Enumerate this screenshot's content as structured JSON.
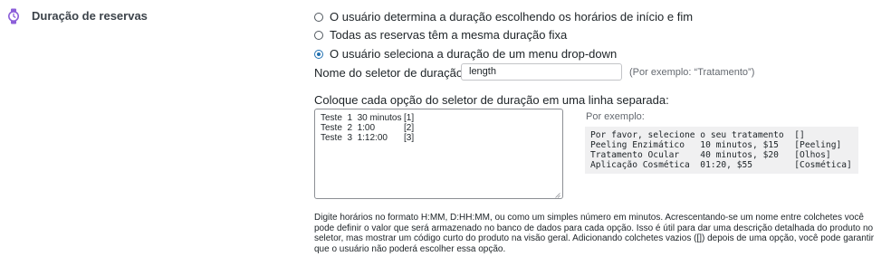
{
  "section": {
    "title": "Duração de reservas",
    "icon": "watch-icon",
    "icon_color": "#8c5fd9"
  },
  "duration_mode": {
    "options": [
      {
        "label": "O usuário determina a duração escolhendo os horários de início e fim",
        "checked": false
      },
      {
        "label": "Todas as reservas têm a mesma duração fixa",
        "checked": false
      },
      {
        "label": "O usuário seleciona a duração de um menu drop-down",
        "checked": true
      }
    ]
  },
  "selector_name": {
    "label": "Nome do seletor de duração:",
    "value": "length",
    "hint": "(Por exemplo: “Tratamento”)"
  },
  "options_list": {
    "label": "Coloque cada opção do seletor de duração em uma linha separada:",
    "lines": [
      {
        "text": "Teste  1  30 minutos",
        "code": "[1]"
      },
      {
        "text": "Teste  2  1:00",
        "code": "[2]"
      },
      {
        "text": "Teste  3  1:12:00",
        "code": "[3]"
      }
    ]
  },
  "example": {
    "label": "Por exemplo:",
    "lines": [
      "Por favor, selecione o seu tratamento  []",
      "Peeling Enzimático   10 minutos, $15   [Peeling]",
      "Tratamento Ocular    40 minutos, $20   [Olhos]",
      "Aplicação Cosmética  01:20, $55        [Cosmética]"
    ]
  },
  "description": "Digite horários no formato H:MM, D:HH:MM, ou como um simples número em minutos. Acrescentando-se um nome entre colchetes você pode definir o valor que será armazenado no banco de dados para cada opção. Isso é útil para dar uma descrição detalhada do produto no seletor, mas mostrar um código curto do produto na visão geral. Adicionando colchetes vazios ([]) depois de uma opção, você pode garantir que o usuário não poderá escolher essa opção.",
  "colors": {
    "accent": "#2271b1",
    "muted_text": "#646970",
    "example_bg": "#f0f0f1"
  }
}
